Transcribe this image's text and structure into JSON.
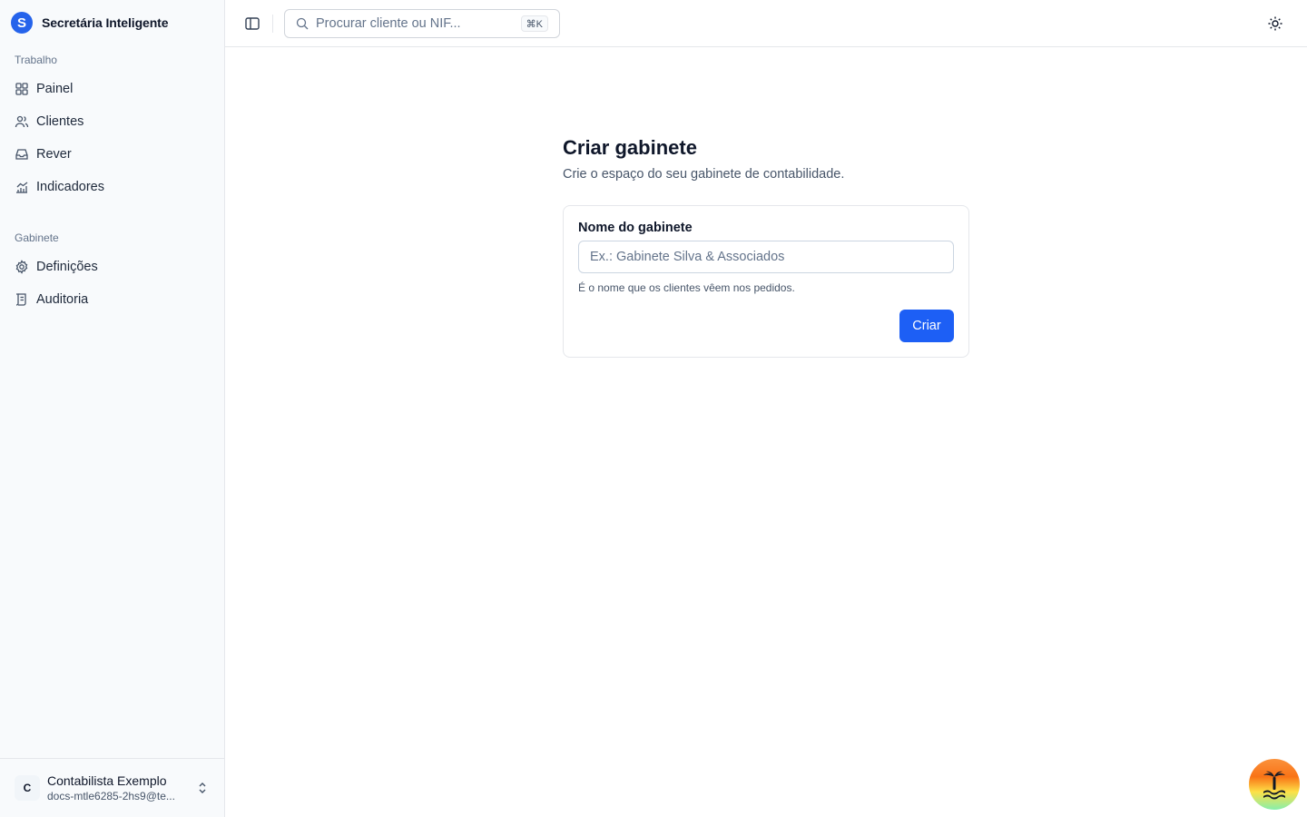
{
  "app": {
    "name": "Secretária Inteligente",
    "logo_letter": "S"
  },
  "sidebar": {
    "sections": [
      {
        "label": "Trabalho",
        "items": [
          {
            "label": "Painel",
            "icon": "grid-icon"
          },
          {
            "label": "Clientes",
            "icon": "users-icon"
          },
          {
            "label": "Rever",
            "icon": "inbox-icon"
          },
          {
            "label": "Indicadores",
            "icon": "chart-icon"
          }
        ]
      },
      {
        "label": "Gabinete",
        "items": [
          {
            "label": "Definições",
            "icon": "gear-icon"
          },
          {
            "label": "Auditoria",
            "icon": "scroll-icon"
          }
        ]
      }
    ],
    "user": {
      "initial": "C",
      "name": "Contabilista Exemplo",
      "email": "docs-mtle6285-2hs9@te..."
    }
  },
  "topbar": {
    "search_placeholder": "Procurar cliente ou NIF...",
    "shortcut": "⌘K"
  },
  "main": {
    "title": "Criar gabinete",
    "subtitle": "Crie o espaço do seu gabinete de contabilidade.",
    "form": {
      "label": "Nome do gabinete",
      "placeholder": "Ex.: Gabinete Silva & Associados",
      "value": "",
      "hint": "É o nome que os clientes vêem nos pedidos.",
      "submit_label": "Criar"
    }
  },
  "colors": {
    "accent": "#1d5ff5",
    "sidebar_bg": "#f8fafc",
    "border": "#e5e7eb"
  }
}
